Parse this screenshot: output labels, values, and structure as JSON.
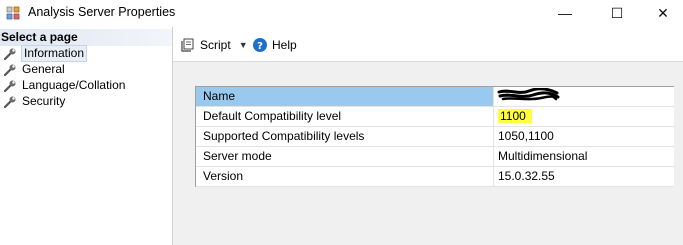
{
  "window": {
    "title": "Analysis Server Properties",
    "controls": {
      "minimize": "—",
      "maximize": "☐",
      "close": "✕"
    }
  },
  "sidebar": {
    "header": "Select a page",
    "items": [
      {
        "label": "Information",
        "icon": "wrench-icon",
        "active": true
      },
      {
        "label": "General",
        "icon": "wrench-icon"
      },
      {
        "label": "Language/Collation",
        "icon": "wrench-icon"
      },
      {
        "label": "Security",
        "icon": "wrench-icon"
      }
    ]
  },
  "toolbar": {
    "script_label": "Script",
    "help_label": "Help"
  },
  "properties": [
    {
      "name": "Name",
      "value": ""
    },
    {
      "name": "Default Compatibility level",
      "value": "1100"
    },
    {
      "name": "Supported Compatibility levels",
      "value": "1050,1100"
    },
    {
      "name": "Server mode",
      "value": "Multidimensional"
    },
    {
      "name": "Version",
      "value": "15.0.32.55"
    }
  ],
  "colors": {
    "selected_row": "#99c9ef",
    "highlight": "#ffff40"
  }
}
